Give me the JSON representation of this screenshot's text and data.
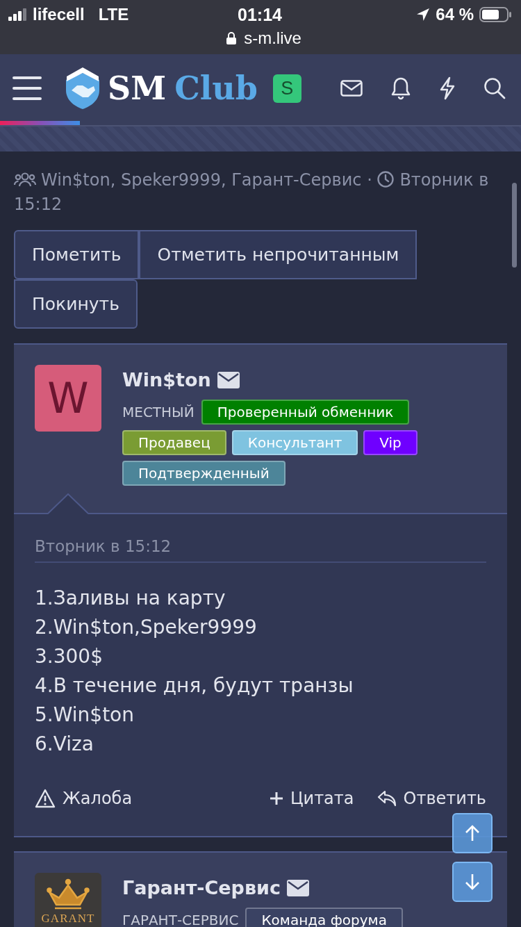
{
  "status_bar": {
    "carrier": "lifecell",
    "network": "LTE",
    "time": "01:14",
    "battery": "64 %",
    "url": "s-m.live"
  },
  "header": {
    "logo_left": "SM",
    "logo_right": "Club",
    "user_initial": "S",
    "loading_bar": {
      "level": 0.153
    }
  },
  "thread_meta": {
    "participants": "Win$ton, Speker9999, Гарант-Сервис",
    "separator": "·",
    "date": "Вторник в 15:12"
  },
  "thread_actions": [
    "Пометить",
    "Отметить непрочитанным",
    "Покинуть"
  ],
  "posts": [
    {
      "author": "Win$ton",
      "avatar": {
        "kind": "letter",
        "text": "W",
        "color": "#d65c7a"
      },
      "user_title": "МЕСТНЫЙ",
      "badges": [
        {
          "label": "Проверенный обменник",
          "color": "#008000"
        },
        {
          "label": "Продавец",
          "color": "#7a9c33"
        },
        {
          "label": "Консультант",
          "color": "#7fc3e0"
        },
        {
          "label": "Vip",
          "color": "#6f00ff"
        },
        {
          "label": "Подтвержденный",
          "color": "#4d8599"
        }
      ],
      "date": "Вторник в 15:12",
      "lines": [
        "1.Заливы на карту",
        "2.Win$ton,Speker9999",
        "3.300$",
        "4.В течение дня, будут транзы",
        "5.Win$ton",
        "6.Viza"
      ],
      "actions": [
        {
          "kind": "report",
          "label": "Жалоба"
        },
        {
          "kind": "quote",
          "label": "Цитата"
        },
        {
          "kind": "reply",
          "label": "Ответить"
        }
      ]
    },
    {
      "author": "Гарант-Сервис",
      "avatar": {
        "kind": "image",
        "text": "GARANT"
      },
      "user_title": "ГАРАНТ-СЕРВИС",
      "badges": [
        {
          "label": "Команда форума",
          "color": "#3a4263"
        }
      ]
    }
  ]
}
